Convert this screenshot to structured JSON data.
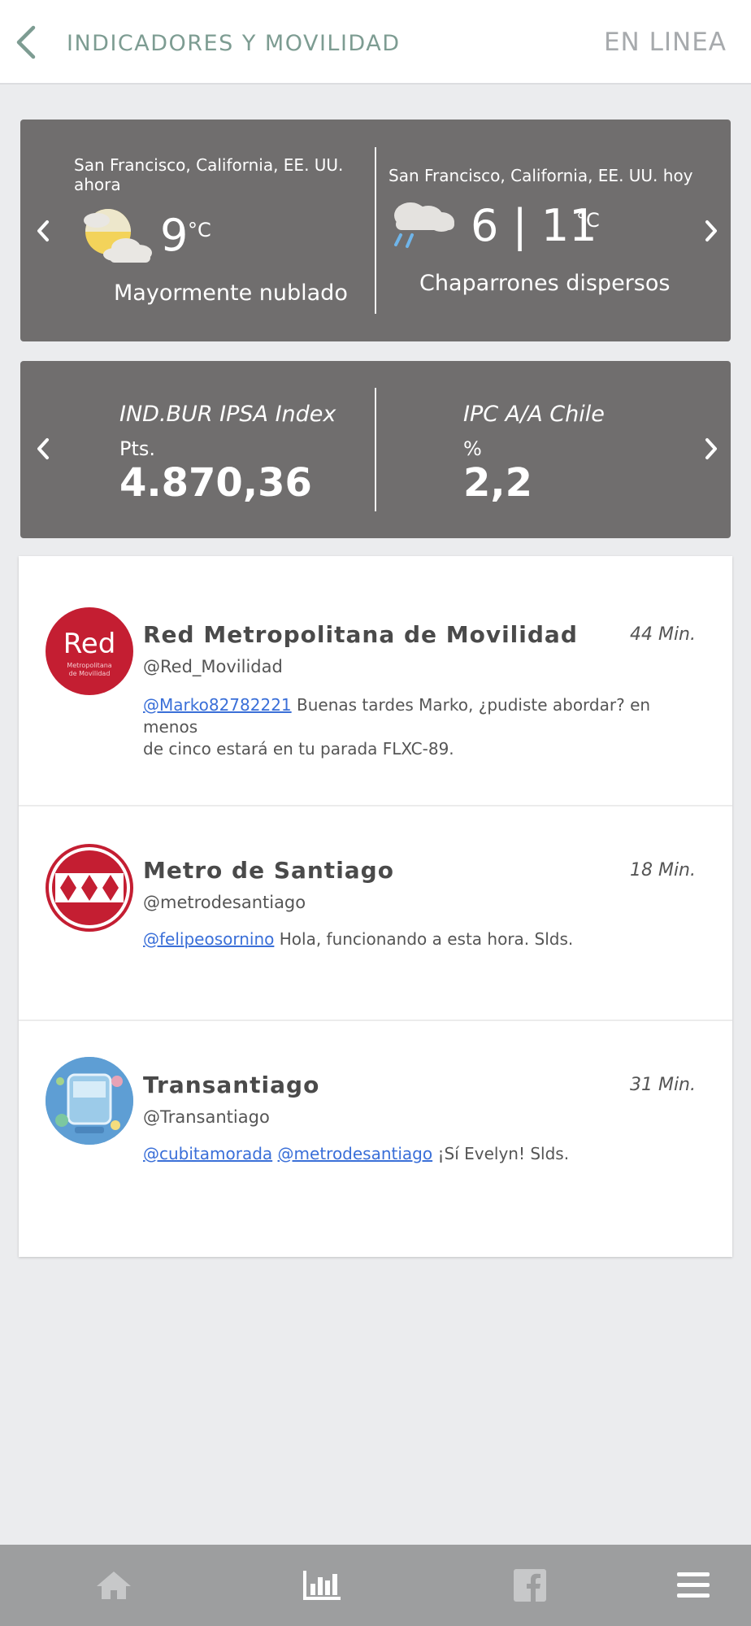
{
  "header": {
    "title": "INDICADORES Y MOVILIDAD",
    "status": "EN LINEA"
  },
  "weather": {
    "current": {
      "location_line1": "San Francisco, California, EE. UU.",
      "location_line2": "ahora",
      "temperature": "9",
      "unit": "°C",
      "description": "Mayormente nublado",
      "icon": "partly-cloudy-icon"
    },
    "today": {
      "location": "San Francisco, California, EE. UU. hoy",
      "temperature": "6 | 11",
      "unit": "°C",
      "description": "Chaparrones dispersos",
      "icon": "rain-showers-icon"
    }
  },
  "indices": [
    {
      "name": "IND.BUR IPSA Index",
      "unit": "Pts.",
      "value": "4.870,36"
    },
    {
      "name": "IPC A/A Chile",
      "unit": "%",
      "value": "2,2"
    }
  ],
  "feed": [
    {
      "name": "Red Metropolitana de Movilidad",
      "handle": "@Red_Movilidad",
      "time": "44 Min.",
      "mention": "@Marko82782221",
      "text_line1": " Buenas tardes Marko, ¿pudiste abordar? en menos",
      "text_line2": "de cinco estará en tu parada FLXC-89.",
      "avatar": {
        "logo": "Red",
        "sub1": "Metropolitana",
        "sub2": "de Movilidad"
      }
    },
    {
      "name": "Metro de Santiago",
      "handle": "@metrodesantiago",
      "time": "18 Min.",
      "mention": "@felipeosornino",
      "text": " Hola, funcionando a esta hora. Slds."
    },
    {
      "name": "Transantiago",
      "handle": "@Transantiago",
      "time": "31 Min.",
      "mention": "@cubitamorada",
      "mention2": "@metrodesantiago",
      "text": " ¡Sí Evelyn! Slds."
    }
  ],
  "nav": [
    "home-icon",
    "chart-icon",
    "facebook-icon",
    "menu-icon"
  ],
  "colors": {
    "accent": "#7d9c92",
    "card": "#706e6e",
    "link": "#3a6fd8",
    "nav_bg": "#9d9e9f",
    "red_brand": "#c41e32"
  }
}
